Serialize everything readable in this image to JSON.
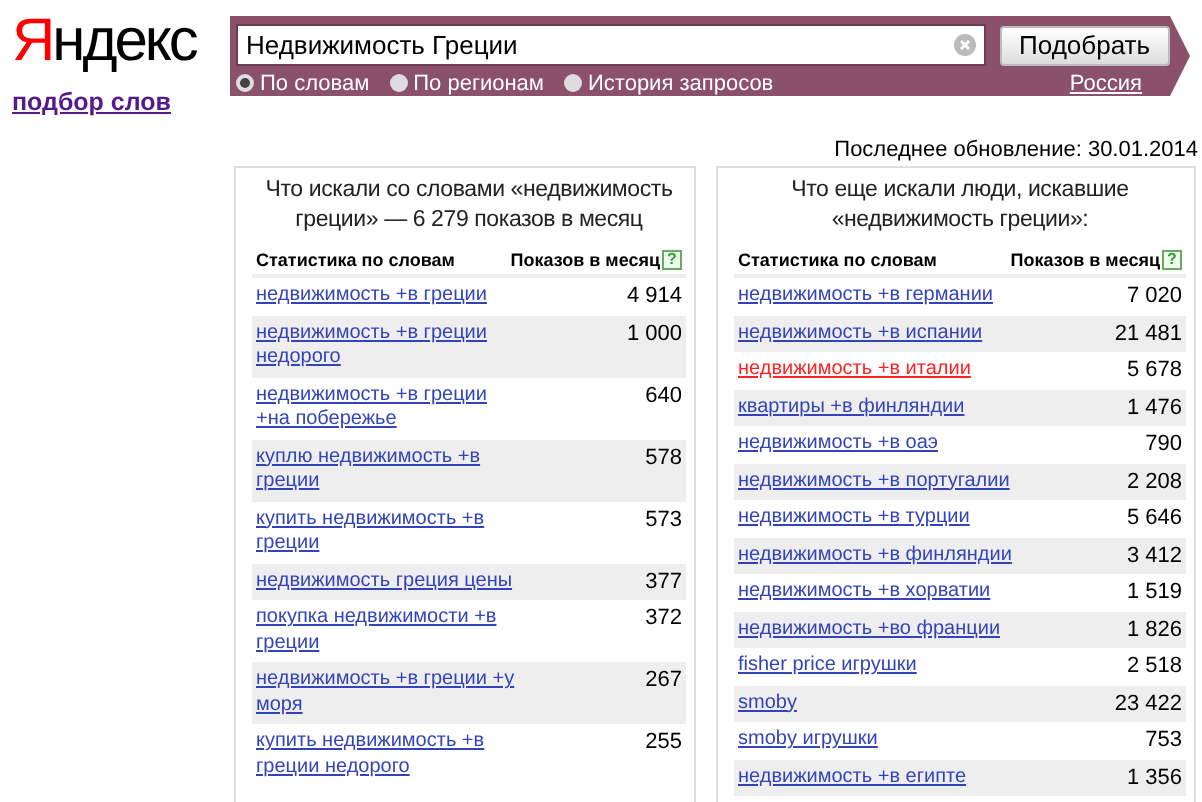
{
  "logo": {
    "text": "Яндекс",
    "subtitle": "подбор слов"
  },
  "search": {
    "value": "Недвижимость Греции",
    "button": "Подобрать",
    "region": "Россия",
    "modes": [
      {
        "label": "По словам",
        "selected": true
      },
      {
        "label": "По регионам",
        "selected": false
      },
      {
        "label": "История запросов",
        "selected": false
      }
    ]
  },
  "last_update": "Последнее обновление: 30.01.2014",
  "panels": [
    {
      "title": "Что искали со словами «недвижимость греции» — 6 279 показов в месяц",
      "columns": [
        "Статистика по словам",
        "Показов в месяц"
      ],
      "help": "?",
      "rows": [
        {
          "phrase": "недвижимость +в греции",
          "count": "4 914",
          "highlighted": false
        },
        {
          "phrase": "недвижимость +в греции недорого",
          "count": "1 000",
          "highlighted": false
        },
        {
          "phrase": "недвижимость +в греции +на побережье",
          "count": "640",
          "highlighted": false
        },
        {
          "phrase": "куплю недвижимость +в греции",
          "count": "578",
          "highlighted": false
        },
        {
          "phrase": "купить недвижимость +в греции",
          "count": "573",
          "highlighted": false
        },
        {
          "phrase": "недвижимость греция цены",
          "count": "377",
          "highlighted": false
        },
        {
          "phrase": "покупка недвижимости +в греции",
          "count": "372",
          "highlighted": false
        },
        {
          "phrase": "недвижимость +в греции +у моря",
          "count": "267",
          "highlighted": false
        },
        {
          "phrase": "купить недвижимость +в греции недорого",
          "count": "255",
          "highlighted": false
        }
      ]
    },
    {
      "title": "Что еще искали люди, искавшие «недвижимость греции»:",
      "columns": [
        "Статистика по словам",
        "Показов в месяц"
      ],
      "help": "?",
      "rows": [
        {
          "phrase": "недвижимость +в германии",
          "count": "7 020",
          "highlighted": false
        },
        {
          "phrase": "недвижимость +в испании",
          "count": "21 481",
          "highlighted": false
        },
        {
          "phrase": "недвижимость +в италии",
          "count": "5 678",
          "highlighted": true
        },
        {
          "phrase": "квартиры +в финляндии",
          "count": "1 476",
          "highlighted": false
        },
        {
          "phrase": "недвижимость +в оаэ",
          "count": "790",
          "highlighted": false
        },
        {
          "phrase": "недвижимость +в португалии",
          "count": "2 208",
          "highlighted": false
        },
        {
          "phrase": "недвижимость +в турции",
          "count": "5 646",
          "highlighted": false
        },
        {
          "phrase": "недвижимость +в финляндии",
          "count": "3 412",
          "highlighted": false
        },
        {
          "phrase": "недвижимость +в хорватии",
          "count": "1 519",
          "highlighted": false
        },
        {
          "phrase": "недвижимость +во франции",
          "count": "1 826",
          "highlighted": false
        },
        {
          "phrase": "fisher price игрушки",
          "count": "2 518",
          "highlighted": false
        },
        {
          "phrase": "smoby",
          "count": "23 422",
          "highlighted": false
        },
        {
          "phrase": "smoby игрушки",
          "count": "753",
          "highlighted": false
        },
        {
          "phrase": "недвижимость +в египте",
          "count": "1 356",
          "highlighted": false
        }
      ]
    }
  ]
}
